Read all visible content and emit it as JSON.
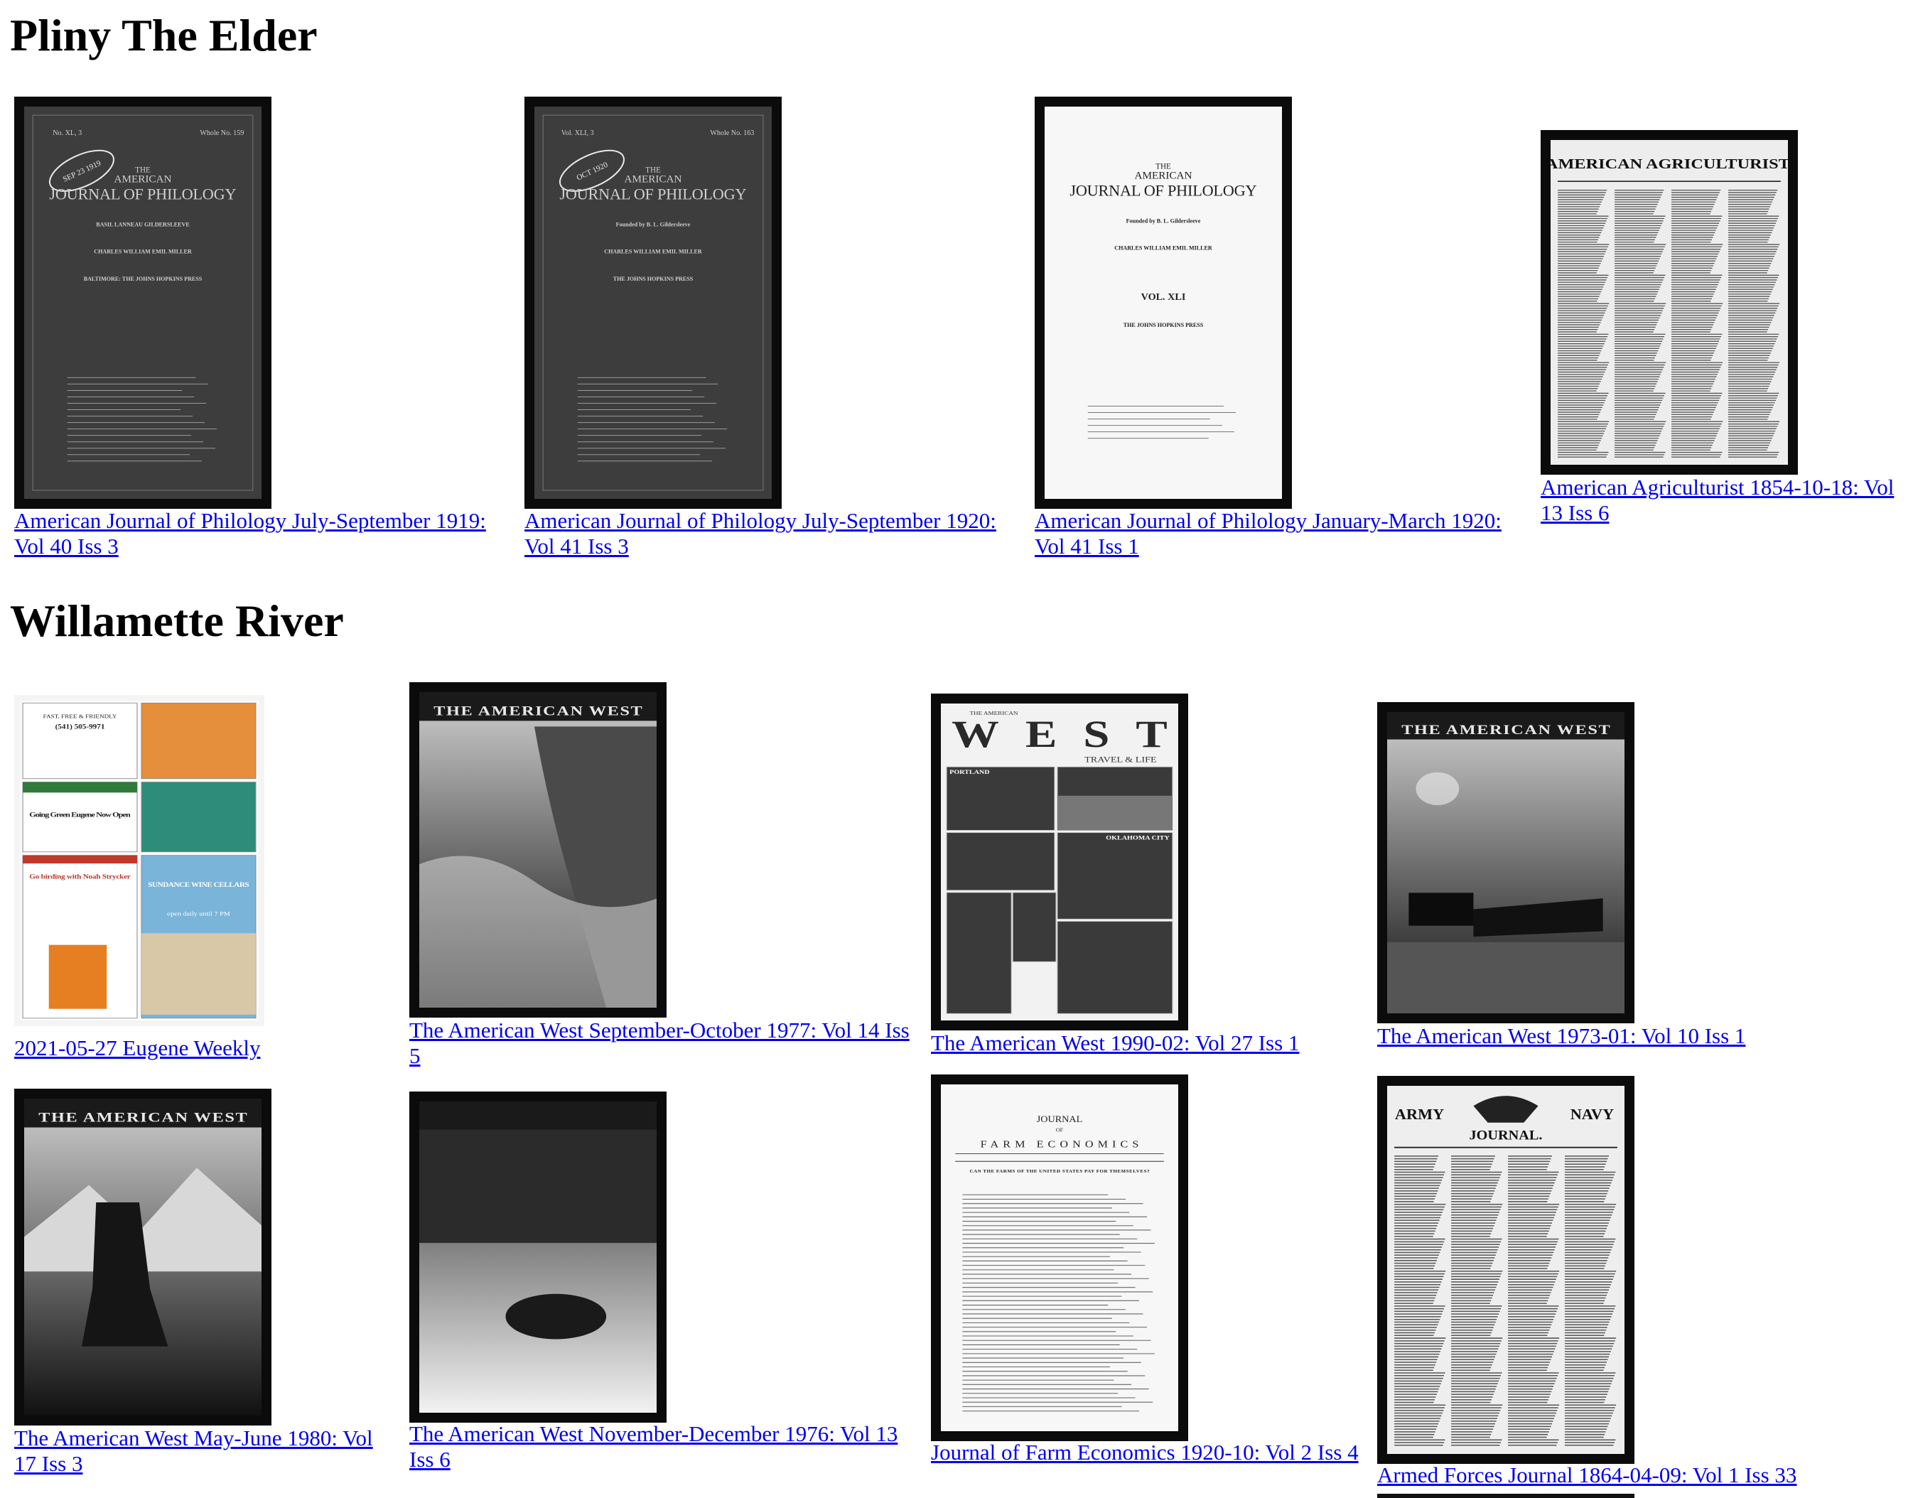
{
  "sections": [
    {
      "title": "Pliny The Elder",
      "items": [
        {
          "caption": "American Journal of Philology July-September 1919: Vol 40 Iss 3",
          "cover": {
            "theme": "dark",
            "top_left": "No. XL, 3",
            "top_right": "Whole No. 159",
            "stamp": "SEP 23 1919",
            "lines": [
              "THE",
              "AMERICAN",
              "JOURNAL OF PHILOLOGY",
              "BASIL LANNEAU GILDERSLEEVE",
              "CHARLES WILLIAM EMIL MILLER",
              "BALTIMORE: THE JOHNS HOPKINS PRESS"
            ]
          }
        },
        {
          "caption": "American Journal of Philology July-September 1920: Vol 41 Iss 3",
          "cover": {
            "theme": "dark",
            "top_left": "Vol. XLI, 3",
            "top_right": "Whole No. 163",
            "stamp": "OCT 1920",
            "lines": [
              "THE",
              "AMERICAN",
              "JOURNAL OF PHILOLOGY",
              "Founded by B. L. Gildersleeve",
              "CHARLES WILLIAM EMIL MILLER",
              "THE JOHNS HOPKINS PRESS"
            ]
          }
        },
        {
          "caption": "American Journal of Philology January-March 1920: Vol 41 Iss 1",
          "cover": {
            "theme": "light",
            "top_left": "",
            "top_right": "",
            "stamp": "",
            "lines": [
              "THE",
              "AMERICAN",
              "JOURNAL OF PHILOLOGY",
              "Founded by B. L. Gildersleeve",
              "CHARLES WILLIAM EMIL MILLER",
              "VOL. XLI",
              "THE JOHNS HOPKINS PRESS"
            ]
          }
        },
        {
          "caption": "American Agriculturist 1854-10-18: Vol 13 Iss 6",
          "cover": {
            "theme": "newspaper",
            "masthead": "AMERICAN AGRICULTURIST."
          }
        }
      ]
    },
    {
      "title": "Willamette River",
      "items": [
        {
          "caption": "2021-05-27 Eugene Weekly",
          "cover": {
            "theme": "ads",
            "blocks": [
              "FAST, FREE & FRIENDLY",
              "(541) 505-9971",
              "Going Green Eugene Now Open",
              "Go birding with Noah Strycker",
              "SUNDANCE WINE CELLARS",
              "open daily until 7 PM"
            ]
          }
        },
        {
          "caption": "The American West September-October 1977: Vol 14 Iss 5",
          "cover": {
            "theme": "photo",
            "masthead": "THE AMERICAN WEST",
            "scene": "coast"
          }
        },
        {
          "caption": "The American West 1990-02: Vol 27 Iss 1",
          "cover": {
            "theme": "travel",
            "small": "THE AMERICAN",
            "masthead": "WEST",
            "sub": "TRAVEL & LIFE",
            "labels": [
              "PORTLAND",
              "OKLAHOMA CITY"
            ]
          }
        },
        {
          "caption": "The American West 1973-01: Vol 10 Iss 1",
          "cover": {
            "theme": "photo",
            "masthead": "THE AMERICAN WEST",
            "scene": "stagecoach"
          }
        },
        {
          "caption": "The American West May-June 1980: Vol 17 Iss 3",
          "cover": {
            "theme": "photo",
            "masthead": "THE AMERICAN WEST",
            "scene": "cowboy"
          }
        },
        {
          "caption": "The American West November-December 1976: Vol 13 Iss 6",
          "cover": {
            "theme": "photo",
            "masthead": "",
            "scene": "bison"
          }
        },
        {
          "caption": "Journal of Farm Economics 1920-10: Vol 2 Iss 4",
          "cover": {
            "theme": "farm",
            "lines": [
              "JOURNAL",
              "OF",
              "FARM ECONOMICS",
              "CAN THE FARMS OF THE UNITED STATES PAY FOR THEMSELVES?"
            ]
          }
        },
        {
          "caption": "Armed Forces Journal 1864-04-09: Vol 1 Iss 33",
          "cover": {
            "theme": "army",
            "left": "ARMY",
            "right": "NAVY",
            "masthead": "JOURNAL."
          }
        }
      ]
    }
  ]
}
